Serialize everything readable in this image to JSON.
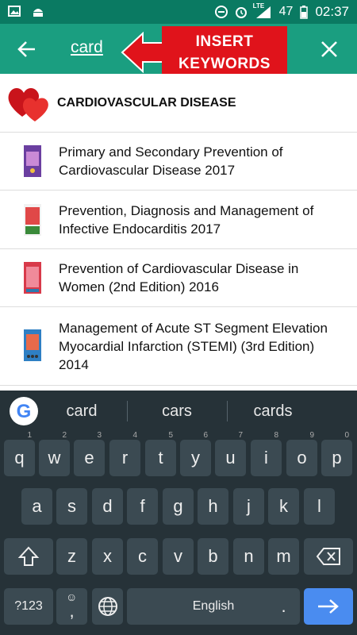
{
  "status_bar": {
    "network": "LTE",
    "battery": "47",
    "time": "02:37"
  },
  "toolbar": {
    "query": "card"
  },
  "callout": {
    "line1": "INSERT",
    "line2": "KEYWORDS"
  },
  "category": {
    "title": "CARDIOVASCULAR DISEASE"
  },
  "results": [
    {
      "title": "Primary and Secondary Prevention of Cardiovascular Disease 2017"
    },
    {
      "title": "Prevention, Diagnosis and Management of Infective Endocarditis 2017"
    },
    {
      "title": "Prevention of Cardiovascular Disease in Women (2nd Edition) 2016"
    },
    {
      "title": "Management of Acute ST Segment Elevation Myocardial Infarction (STEMI) (3rd Edition) 2014"
    }
  ],
  "keyboard": {
    "suggestions": [
      "card",
      "cars",
      "cards"
    ],
    "row1": [
      "q",
      "w",
      "e",
      "r",
      "t",
      "y",
      "u",
      "i",
      "o",
      "p"
    ],
    "row1_hints": [
      "1",
      "2",
      "3",
      "4",
      "5",
      "6",
      "7",
      "8",
      "9",
      "0"
    ],
    "row2": [
      "a",
      "s",
      "d",
      "f",
      "g",
      "h",
      "j",
      "k",
      "l"
    ],
    "row3": [
      "z",
      "x",
      "c",
      "v",
      "b",
      "n",
      "m"
    ],
    "symbols_key": "?123",
    "comma_key": ",",
    "space_label": "English",
    "period_key": "."
  }
}
